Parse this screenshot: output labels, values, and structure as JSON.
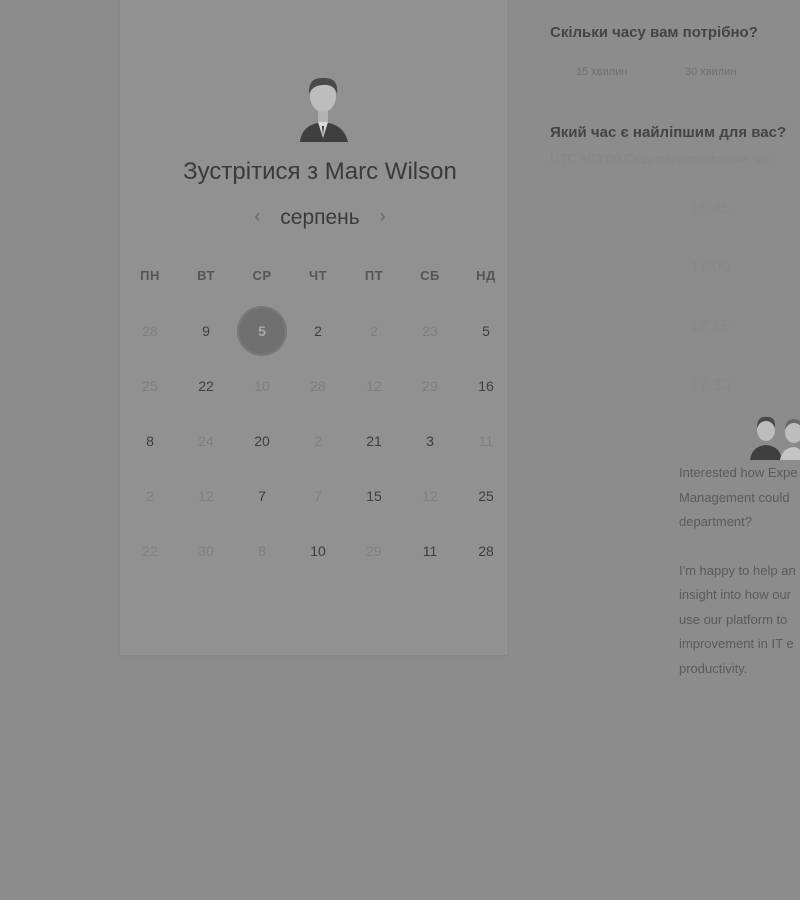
{
  "host": {
    "title": "Зустрітися з Marc Wilson"
  },
  "calendar": {
    "month": "серпень",
    "prev_icon": "chevron-left-icon",
    "next_icon": "chevron-right-icon",
    "weekdays": [
      "ПН",
      "ВТ",
      "СР",
      "ЧТ",
      "ПТ",
      "СБ",
      "НД"
    ],
    "weeks": [
      [
        {
          "d": "28",
          "on": false
        },
        {
          "d": "9",
          "on": true
        },
        {
          "d": "5",
          "on": true,
          "selected": true
        },
        {
          "d": "2",
          "on": true
        },
        {
          "d": "2",
          "on": false
        },
        {
          "d": "23",
          "on": false
        },
        {
          "d": "5",
          "on": true
        }
      ],
      [
        {
          "d": "25",
          "on": false
        },
        {
          "d": "22",
          "on": true
        },
        {
          "d": "10",
          "on": false
        },
        {
          "d": "28",
          "on": false
        },
        {
          "d": "12",
          "on": false
        },
        {
          "d": "29",
          "on": false
        },
        {
          "d": "16",
          "on": true
        }
      ],
      [
        {
          "d": "8",
          "on": true
        },
        {
          "d": "24",
          "on": false
        },
        {
          "d": "20",
          "on": true
        },
        {
          "d": "2",
          "on": false
        },
        {
          "d": "21",
          "on": true
        },
        {
          "d": "3",
          "on": true
        },
        {
          "d": "11",
          "on": false
        }
      ],
      [
        {
          "d": "2",
          "on": false
        },
        {
          "d": "12",
          "on": false
        },
        {
          "d": "7",
          "on": true
        },
        {
          "d": "7",
          "on": false
        },
        {
          "d": "15",
          "on": true
        },
        {
          "d": "12",
          "on": false
        },
        {
          "d": "25",
          "on": true
        }
      ],
      [
        {
          "d": "22",
          "on": false
        },
        {
          "d": "30",
          "on": false
        },
        {
          "d": "8",
          "on": false
        },
        {
          "d": "10",
          "on": true
        },
        {
          "d": "29",
          "on": false
        },
        {
          "d": "11",
          "on": true
        },
        {
          "d": "28",
          "on": true
        }
      ]
    ]
  },
  "booking": {
    "duration_question": "Скільки часу вам потрібно?",
    "durations": [
      "15 хвилин",
      "30 хвилин"
    ],
    "time_question": "Який час є найліпшим для вас?",
    "timezone": "UTC +03:00 Східноєвропейський час",
    "slots": [
      "16:45",
      "17:00",
      "17:15",
      "17:30"
    ]
  },
  "message": {
    "paragraph1": [
      "Interested how Expe",
      "Management could",
      "department?"
    ],
    "paragraph2": [
      "I'm happy to help an",
      "insight into how our",
      "use our platform to",
      "improvement in IT e",
      "productivity."
    ]
  }
}
